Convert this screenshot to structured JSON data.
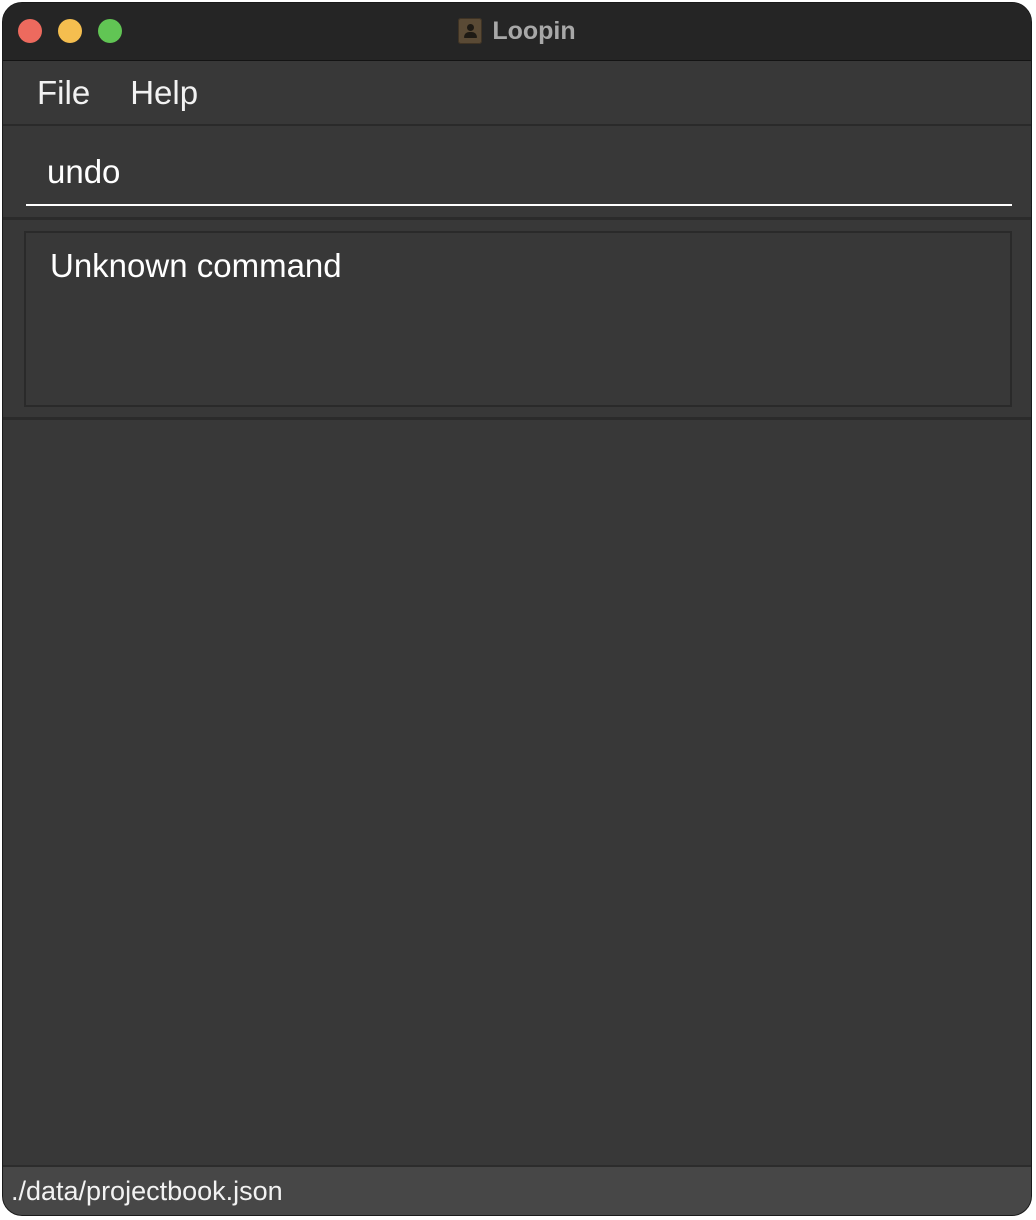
{
  "window": {
    "title": "Loopin",
    "app_icon": "address-book-icon"
  },
  "menu": {
    "items": [
      {
        "label": "File"
      },
      {
        "label": "Help"
      }
    ]
  },
  "command": {
    "value": "undo"
  },
  "result": {
    "message": "Unknown command"
  },
  "status": {
    "file_path": "./data/projectbook.json"
  },
  "colors": {
    "background": "#383838",
    "titlebar": "#252525",
    "statusbar": "#474747",
    "close": "#ed6a5e",
    "minimize": "#f5be4f",
    "zoom": "#61c554"
  }
}
